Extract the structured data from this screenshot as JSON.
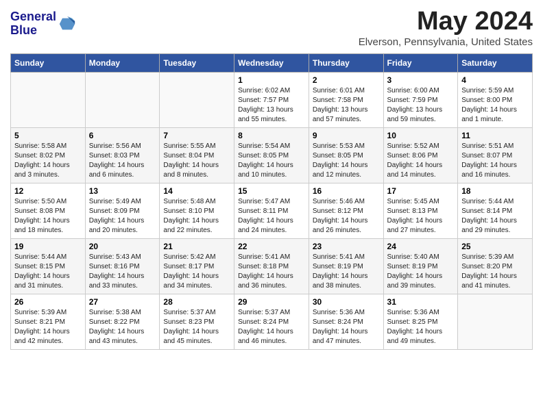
{
  "header": {
    "logo_line1": "General",
    "logo_line2": "Blue",
    "month_title": "May 2024",
    "subtitle": "Elverson, Pennsylvania, United States"
  },
  "weekdays": [
    "Sunday",
    "Monday",
    "Tuesday",
    "Wednesday",
    "Thursday",
    "Friday",
    "Saturday"
  ],
  "weeks": [
    [
      {
        "day": "",
        "info": ""
      },
      {
        "day": "",
        "info": ""
      },
      {
        "day": "",
        "info": ""
      },
      {
        "day": "1",
        "info": "Sunrise: 6:02 AM\nSunset: 7:57 PM\nDaylight: 13 hours\nand 55 minutes."
      },
      {
        "day": "2",
        "info": "Sunrise: 6:01 AM\nSunset: 7:58 PM\nDaylight: 13 hours\nand 57 minutes."
      },
      {
        "day": "3",
        "info": "Sunrise: 6:00 AM\nSunset: 7:59 PM\nDaylight: 13 hours\nand 59 minutes."
      },
      {
        "day": "4",
        "info": "Sunrise: 5:59 AM\nSunset: 8:00 PM\nDaylight: 14 hours\nand 1 minute."
      }
    ],
    [
      {
        "day": "5",
        "info": "Sunrise: 5:58 AM\nSunset: 8:02 PM\nDaylight: 14 hours\nand 3 minutes."
      },
      {
        "day": "6",
        "info": "Sunrise: 5:56 AM\nSunset: 8:03 PM\nDaylight: 14 hours\nand 6 minutes."
      },
      {
        "day": "7",
        "info": "Sunrise: 5:55 AM\nSunset: 8:04 PM\nDaylight: 14 hours\nand 8 minutes."
      },
      {
        "day": "8",
        "info": "Sunrise: 5:54 AM\nSunset: 8:05 PM\nDaylight: 14 hours\nand 10 minutes."
      },
      {
        "day": "9",
        "info": "Sunrise: 5:53 AM\nSunset: 8:05 PM\nDaylight: 14 hours\nand 12 minutes."
      },
      {
        "day": "10",
        "info": "Sunrise: 5:52 AM\nSunset: 8:06 PM\nDaylight: 14 hours\nand 14 minutes."
      },
      {
        "day": "11",
        "info": "Sunrise: 5:51 AM\nSunset: 8:07 PM\nDaylight: 14 hours\nand 16 minutes."
      }
    ],
    [
      {
        "day": "12",
        "info": "Sunrise: 5:50 AM\nSunset: 8:08 PM\nDaylight: 14 hours\nand 18 minutes."
      },
      {
        "day": "13",
        "info": "Sunrise: 5:49 AM\nSunset: 8:09 PM\nDaylight: 14 hours\nand 20 minutes."
      },
      {
        "day": "14",
        "info": "Sunrise: 5:48 AM\nSunset: 8:10 PM\nDaylight: 14 hours\nand 22 minutes."
      },
      {
        "day": "15",
        "info": "Sunrise: 5:47 AM\nSunset: 8:11 PM\nDaylight: 14 hours\nand 24 minutes."
      },
      {
        "day": "16",
        "info": "Sunrise: 5:46 AM\nSunset: 8:12 PM\nDaylight: 14 hours\nand 26 minutes."
      },
      {
        "day": "17",
        "info": "Sunrise: 5:45 AM\nSunset: 8:13 PM\nDaylight: 14 hours\nand 27 minutes."
      },
      {
        "day": "18",
        "info": "Sunrise: 5:44 AM\nSunset: 8:14 PM\nDaylight: 14 hours\nand 29 minutes."
      }
    ],
    [
      {
        "day": "19",
        "info": "Sunrise: 5:44 AM\nSunset: 8:15 PM\nDaylight: 14 hours\nand 31 minutes."
      },
      {
        "day": "20",
        "info": "Sunrise: 5:43 AM\nSunset: 8:16 PM\nDaylight: 14 hours\nand 33 minutes."
      },
      {
        "day": "21",
        "info": "Sunrise: 5:42 AM\nSunset: 8:17 PM\nDaylight: 14 hours\nand 34 minutes."
      },
      {
        "day": "22",
        "info": "Sunrise: 5:41 AM\nSunset: 8:18 PM\nDaylight: 14 hours\nand 36 minutes."
      },
      {
        "day": "23",
        "info": "Sunrise: 5:41 AM\nSunset: 8:19 PM\nDaylight: 14 hours\nand 38 minutes."
      },
      {
        "day": "24",
        "info": "Sunrise: 5:40 AM\nSunset: 8:19 PM\nDaylight: 14 hours\nand 39 minutes."
      },
      {
        "day": "25",
        "info": "Sunrise: 5:39 AM\nSunset: 8:20 PM\nDaylight: 14 hours\nand 41 minutes."
      }
    ],
    [
      {
        "day": "26",
        "info": "Sunrise: 5:39 AM\nSunset: 8:21 PM\nDaylight: 14 hours\nand 42 minutes."
      },
      {
        "day": "27",
        "info": "Sunrise: 5:38 AM\nSunset: 8:22 PM\nDaylight: 14 hours\nand 43 minutes."
      },
      {
        "day": "28",
        "info": "Sunrise: 5:37 AM\nSunset: 8:23 PM\nDaylight: 14 hours\nand 45 minutes."
      },
      {
        "day": "29",
        "info": "Sunrise: 5:37 AM\nSunset: 8:24 PM\nDaylight: 14 hours\nand 46 minutes."
      },
      {
        "day": "30",
        "info": "Sunrise: 5:36 AM\nSunset: 8:24 PM\nDaylight: 14 hours\nand 47 minutes."
      },
      {
        "day": "31",
        "info": "Sunrise: 5:36 AM\nSunset: 8:25 PM\nDaylight: 14 hours\nand 49 minutes."
      },
      {
        "day": "",
        "info": ""
      }
    ]
  ]
}
